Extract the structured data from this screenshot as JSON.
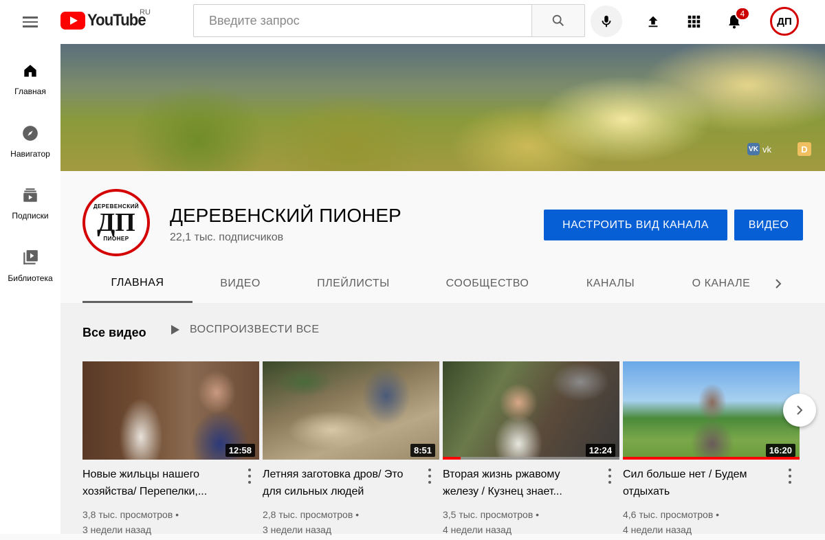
{
  "topbar": {
    "logo_text": "YouTube",
    "country_code": "RU",
    "search_placeholder": "Введите запрос",
    "notifications_count": "4",
    "avatar_text": "ДП"
  },
  "sidebar": {
    "items": [
      {
        "label": "Главная",
        "icon": "home-icon"
      },
      {
        "label": "Навигатор",
        "icon": "compass-icon"
      },
      {
        "label": "Подписки",
        "icon": "subscriptions-icon"
      },
      {
        "label": "Библиотека",
        "icon": "library-icon"
      }
    ]
  },
  "banner": {
    "vk_label": "vk",
    "vk_icon_text": "VK",
    "patreon_icon_text": "D"
  },
  "channel": {
    "name": "ДЕРЕВЕНСКИЙ ПИОНЕР",
    "subscribers": "22,1 тыс. подписчиков",
    "avatar_text": "ДП",
    "avatar_top_text": "ДЕРЕВЕНСКИЙ",
    "avatar_bottom_text": "ПИОНЕР",
    "customize_button": "НАСТРОИТЬ ВИД КАНАЛА",
    "videos_button": "ВИДЕО"
  },
  "tabs": [
    {
      "label": "ГЛАВНАЯ",
      "active": true
    },
    {
      "label": "ВИДЕО",
      "active": false
    },
    {
      "label": "ПЛЕЙЛИСТЫ",
      "active": false
    },
    {
      "label": "СООБЩЕСТВО",
      "active": false
    },
    {
      "label": "КАНАЛЫ",
      "active": false
    },
    {
      "label": "О КАНАЛЕ",
      "active": false
    }
  ],
  "shelf": {
    "title": "Все видео",
    "play_all": "ВОСПРОИЗВЕСТИ ВСЕ"
  },
  "videos": [
    {
      "title": "Новые жильцы нашего хозяйства/ Перепелки,...",
      "views": "3,8 тыс. просмотров •",
      "age": "3 недели назад",
      "duration": "12:58",
      "progress": 0
    },
    {
      "title": "Летняя заготовка дров/ Это для сильных людей",
      "views": "2,8 тыс. просмотров •",
      "age": "3 недели назад",
      "duration": "8:51",
      "progress": 0
    },
    {
      "title": "Вторая жизнь ржавому железу / Кузнец знает...",
      "views": "3,5 тыс. просмотров •",
      "age": "4 недели назад",
      "duration": "12:24",
      "progress": 0.1
    },
    {
      "title": "Сил больше нет / Будем отдыхать",
      "views": "4,6 тыс. просмотров •",
      "age": "4 недели назад",
      "duration": "16:20",
      "progress": 1.0
    }
  ],
  "colors": {
    "accent_blue": "#065fd4",
    "brand_red": "#ff0000",
    "badge_red": "#cc0000"
  }
}
